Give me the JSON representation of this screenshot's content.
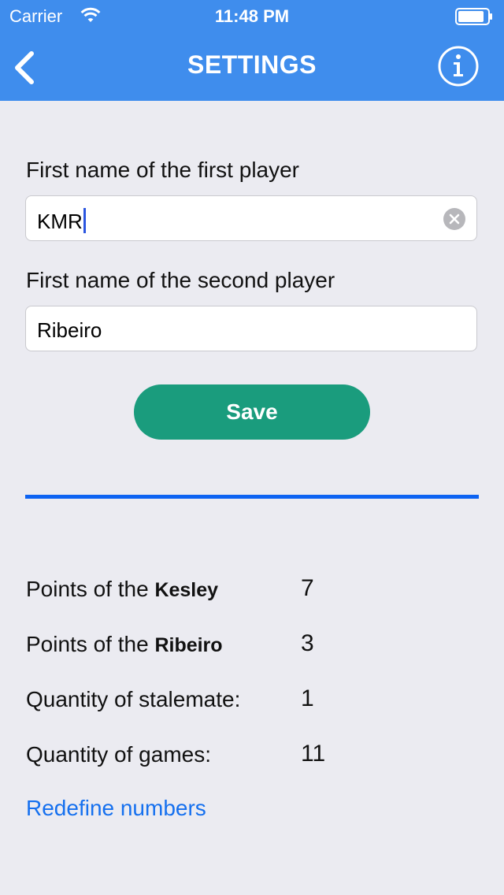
{
  "status_bar": {
    "carrier": "Carrier",
    "time": "11:48 PM",
    "wifi_icon": "wifi-icon",
    "battery_icon": "battery-icon"
  },
  "nav": {
    "title": "SETTINGS",
    "back_icon": "chevron-left-icon",
    "info_icon": "info-icon"
  },
  "form": {
    "first_player": {
      "label": "First name of the first player",
      "value": "KMR",
      "focused": true
    },
    "second_player": {
      "label": "First name of the second player",
      "value": "Ribeiro"
    },
    "save_label": "Save"
  },
  "stats": {
    "player1": {
      "prefix": "Points of the ",
      "name": "Kesley",
      "value": "7"
    },
    "player2": {
      "prefix": "Points of the ",
      "name": "Ribeiro",
      "value": "3"
    },
    "stalemate": {
      "label": "Quantity of stalemate:",
      "value": "1"
    },
    "games": {
      "label": "Quantity of games:",
      "value": "11"
    },
    "redefine_label": "Redefine numbers"
  },
  "colors": {
    "header": "#3f8ded",
    "background": "#ebebf1",
    "save_button": "#1a9c7d",
    "divider": "#0d63f2",
    "link": "#1570ef"
  }
}
